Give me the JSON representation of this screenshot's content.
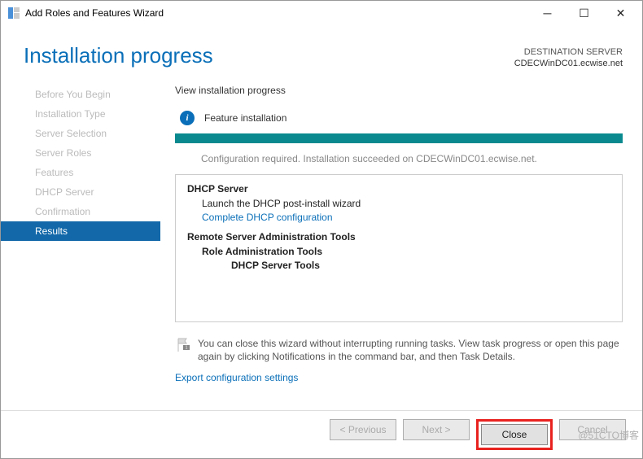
{
  "titlebar": {
    "title": "Add Roles and Features Wizard"
  },
  "header": {
    "page_title": "Installation progress",
    "dest_label": "DESTINATION SERVER",
    "dest_server": "CDECWinDC01.ecwise.net"
  },
  "sidebar": {
    "items": [
      {
        "label": "Before You Begin"
      },
      {
        "label": "Installation Type"
      },
      {
        "label": "Server Selection"
      },
      {
        "label": "Server Roles"
      },
      {
        "label": "Features"
      },
      {
        "label": "DHCP Server"
      },
      {
        "label": "Confirmation"
      },
      {
        "label": "Results"
      }
    ],
    "active_index": 7
  },
  "main": {
    "subhead": "View installation progress",
    "feature_label": "Feature installation",
    "config_msg": "Configuration required. Installation succeeded on CDECWinDC01.ecwise.net.",
    "results": {
      "dhcp_title": "DHCP Server",
      "dhcp_sub": "Launch the DHCP post-install wizard",
      "dhcp_link": "Complete DHCP configuration",
      "rsat_title": "Remote Server Administration Tools",
      "rsat_sub1": "Role Administration Tools",
      "rsat_sub2": "DHCP Server Tools"
    },
    "note": "You can close this wizard without interrupting running tasks. View task progress or open this page again by clicking Notifications in the command bar, and then Task Details.",
    "export_link": "Export configuration settings"
  },
  "footer": {
    "previous": "< Previous",
    "next": "Next >",
    "close": "Close",
    "cancel": "Cancel"
  },
  "watermark": "@51CTO博客"
}
